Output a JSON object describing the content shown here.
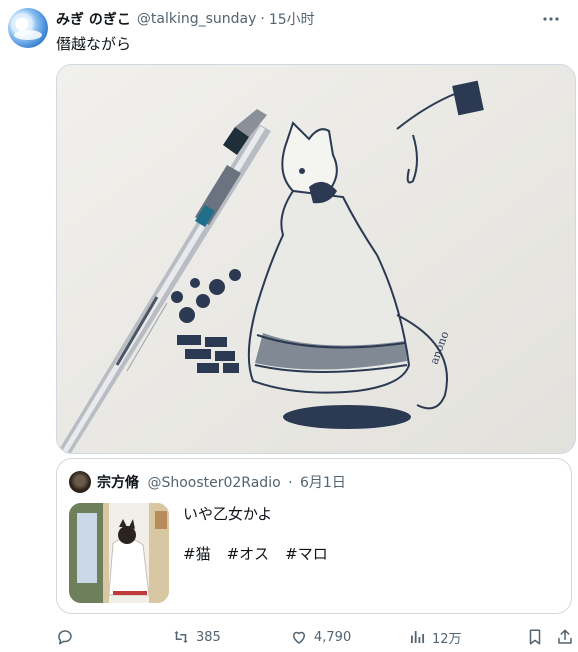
{
  "post": {
    "display_name": "みぎ のぎこ",
    "handle": "@talking_sunday",
    "separator": "·",
    "time": "15小时",
    "text": "僭越ながら"
  },
  "quote": {
    "display_name": "宗方脩",
    "handle": "@Shooster02Radio",
    "separator": "·",
    "date": "6月1日",
    "text": "いや乙女かよ",
    "hashtags": [
      "#猫",
      "#オス",
      "#マロ"
    ]
  },
  "actions": {
    "reply_count": "",
    "repost_count": "385",
    "like_count": "4,790",
    "view_count": "12万"
  },
  "icons": [
    "avatar",
    "more-icon",
    "reply-icon",
    "repost-icon",
    "like-icon",
    "views-icon",
    "bookmark-icon",
    "share-icon"
  ]
}
